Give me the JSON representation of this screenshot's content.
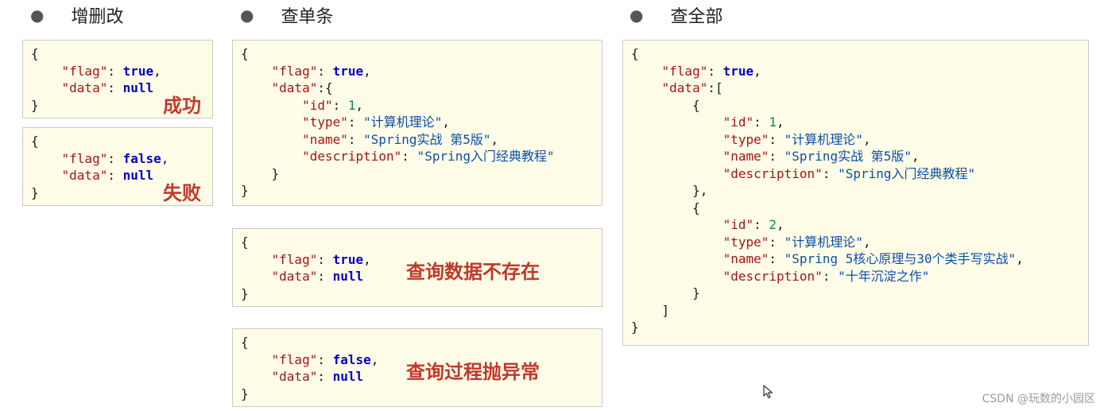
{
  "headings": {
    "crud": "增删改",
    "single": "查单条",
    "all": "查全部"
  },
  "boxes": {
    "crud_success": {
      "lines": [
        "{",
        "    \"flag\": true,",
        "    \"data\": null",
        "}"
      ],
      "note": "成功"
    },
    "crud_fail": {
      "lines": [
        "{",
        "    \"flag\": false,",
        "    \"data\": null",
        "}"
      ],
      "note": "失败"
    },
    "single_ok": {
      "lines": [
        "{",
        "    \"flag\": true,",
        "    \"data\":{",
        "        \"id\": 1,",
        "        \"type\": \"计算机理论\",",
        "        \"name\": \"Spring实战 第5版\",",
        "        \"description\": \"Spring入门经典教程\"",
        "    }",
        "}"
      ]
    },
    "single_notfound": {
      "lines": [
        "{",
        "    \"flag\": true,",
        "    \"data\": null",
        "}"
      ],
      "note": "查询数据不存在"
    },
    "single_error": {
      "lines": [
        "{",
        "    \"flag\": false,",
        "    \"data\": null",
        "}"
      ],
      "note": "查询过程抛异常"
    },
    "all_ok": {
      "lines": [
        "{",
        "    \"flag\": true,",
        "    \"data\":[",
        "        {",
        "            \"id\": 1,",
        "            \"type\": \"计算机理论\",",
        "            \"name\": \"Spring实战 第5版\",",
        "            \"description\": \"Spring入门经典教程\"",
        "        },",
        "        {",
        "            \"id\": 2,",
        "            \"type\": \"计算机理论\",",
        "            \"name\": \"Spring 5核心原理与30个类手写实战\",",
        "            \"description\": \"十年沉淀之作\"",
        "        }",
        "    ]",
        "}"
      ]
    }
  },
  "watermark": "CSDN @玩数的小园区",
  "colors": {
    "box_bg": "#fffde8",
    "key": "#a31515",
    "string": "#0a4fa8",
    "keyword": "#0000c8",
    "number": "#098658",
    "note": "#c0392b"
  }
}
